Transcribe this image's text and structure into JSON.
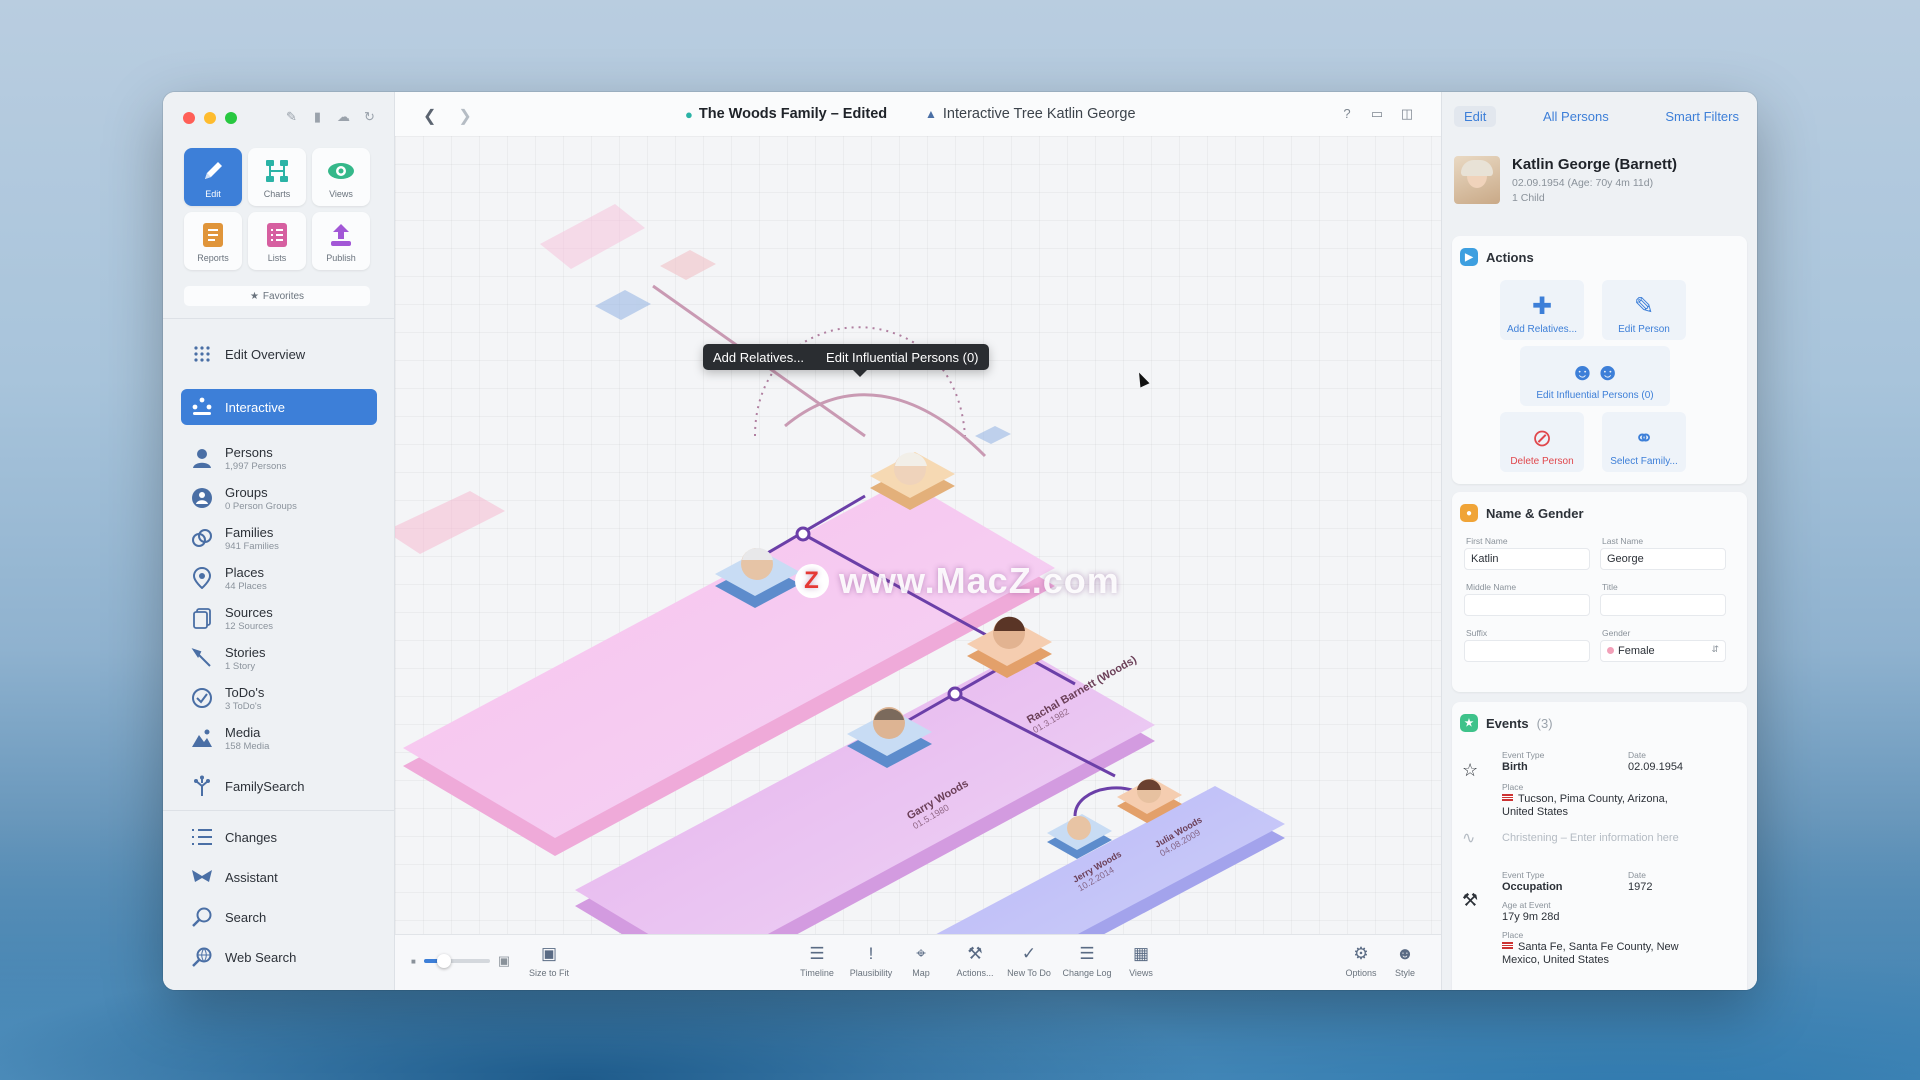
{
  "window": {
    "doc_title": "The Woods Family – Edited",
    "tree_title": "Interactive Tree Katlin George"
  },
  "sidebar": {
    "modes": [
      {
        "label": "Edit",
        "icon": "pencil-icon"
      },
      {
        "label": "Charts",
        "icon": "charts-icon"
      },
      {
        "label": "Views",
        "icon": "eye-icon"
      },
      {
        "label": "Reports",
        "icon": "reports-icon"
      },
      {
        "label": "Lists",
        "icon": "lists-icon"
      },
      {
        "label": "Publish",
        "icon": "publish-icon"
      }
    ],
    "favorites": "Favorites",
    "edit_overview": "Edit Overview",
    "interactive": "Interactive",
    "items": [
      {
        "label": "Persons",
        "sub": "1,997 Persons"
      },
      {
        "label": "Groups",
        "sub": "0 Person Groups"
      },
      {
        "label": "Families",
        "sub": "941 Families"
      },
      {
        "label": "Places",
        "sub": "44 Places"
      },
      {
        "label": "Sources",
        "sub": "12 Sources"
      },
      {
        "label": "Stories",
        "sub": "1 Story"
      },
      {
        "label": "ToDo's",
        "sub": "3 ToDo's"
      },
      {
        "label": "Media",
        "sub": "158 Media"
      }
    ],
    "familysearch": "FamilySearch",
    "tools": [
      {
        "label": "Changes"
      },
      {
        "label": "Assistant"
      },
      {
        "label": "Search"
      },
      {
        "label": "Web Search"
      }
    ]
  },
  "canvas": {
    "tooltip": {
      "add": "Add Relatives...",
      "influential": "Edit Influential Persons (0)"
    },
    "watermark": "www.MacZ.com",
    "watermark_logo": "Z",
    "people": [
      {
        "name": "Rachal Barnett (Woods)",
        "date": "01.3.1982"
      },
      {
        "name": "Garry Woods",
        "date": "01.5.1980"
      },
      {
        "name": "Jerry Woods",
        "date": "10.2.2014"
      },
      {
        "name": "Julia Woods",
        "date": "04.08.2009"
      }
    ]
  },
  "bottombar": {
    "size_to_fit": "Size to Fit",
    "zoom_level": 0.3,
    "tools": [
      {
        "label": "Timeline",
        "icon": "timeline-icon"
      },
      {
        "label": "Plausibility",
        "icon": "exclamation-icon"
      },
      {
        "label": "Map",
        "icon": "map-icon"
      },
      {
        "label": "Actions...",
        "icon": "actions-icon"
      },
      {
        "label": "New To Do",
        "icon": "checkmark-icon"
      },
      {
        "label": "Change Log",
        "icon": "list-icon"
      },
      {
        "label": "Views",
        "icon": "views-icon"
      }
    ],
    "options": "Options",
    "style": "Style"
  },
  "inspector": {
    "tabs": [
      "Edit",
      "All Persons",
      "Smart Filters"
    ],
    "person": {
      "name": "Katlin George (Barnett)",
      "dates": "02.09.1954 (Age: 70y 4m 11d)",
      "children": "1 Child"
    },
    "actions": {
      "title": "Actions",
      "add_relatives": "Add Relatives...",
      "edit_person": "Edit Person",
      "edit_influential": "Edit Influential Persons (0)",
      "delete_person": "Delete Person",
      "select_family": "Select Family..."
    },
    "name_gender": {
      "title": "Name & Gender",
      "first_name_label": "First Name",
      "first_name": "Katlin",
      "last_name_label": "Last Name",
      "last_name": "George",
      "middle_name_label": "Middle Name",
      "title_label": "Title",
      "suffix_label": "Suffix",
      "gender_label": "Gender",
      "gender": "Female"
    },
    "events": {
      "title": "Events",
      "count": "(3)",
      "event_type_label": "Event Type",
      "date_label": "Date",
      "place_label": "Place",
      "age_label": "Age at Event",
      "birth_type": "Birth",
      "birth_date": "02.09.1954",
      "birth_place": "Tucson, Pima County, Arizona, United States",
      "christening_placeholder": "Christening – Enter information here",
      "occupation_type": "Occupation",
      "occupation_date": "1972",
      "occupation_age": "17y 9m 28d",
      "occupation_place": "Santa Fe, Santa Fe County, New Mexico, United States"
    }
  },
  "colors": {
    "accent": "#3d7fd8",
    "danger": "#e0474c",
    "tree_pink": "#f7c6ea",
    "tree_purple": "#d9b3f0",
    "tree_lavender": "#bcc4f7",
    "connector": "#6b3fa8"
  }
}
